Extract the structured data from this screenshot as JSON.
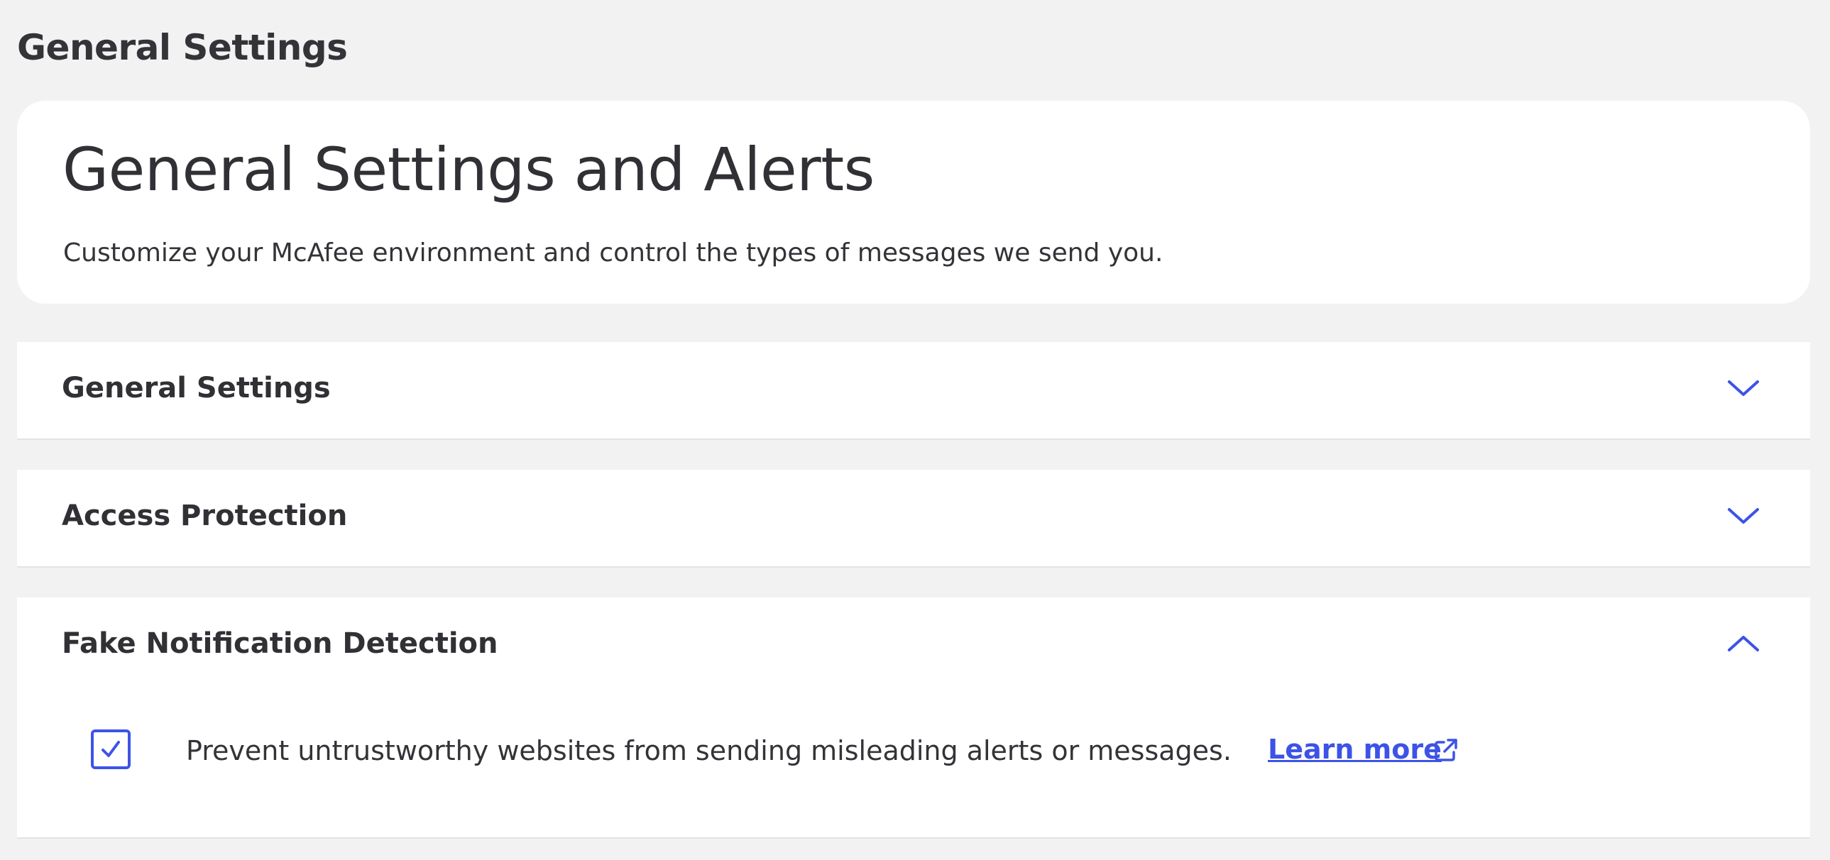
{
  "page": {
    "title": "General Settings"
  },
  "hero": {
    "title": "General Settings and Alerts",
    "subtitle": "Customize your McAfee environment and control the types of messages we send you."
  },
  "sections": [
    {
      "title": "General Settings",
      "expanded": false
    },
    {
      "title": "Access Protection",
      "expanded": false
    },
    {
      "title": "Fake Notification Detection",
      "expanded": true,
      "option": {
        "checked": true,
        "label": "Prevent untrustworthy websites from sending misleading alerts or messages.",
        "link_label": "Learn more"
      }
    }
  ],
  "colors": {
    "accent": "#3d53e6",
    "background": "#f2f2f2",
    "card": "#ffffff",
    "text": "#303035"
  },
  "icons": {
    "collapsed": "chevron-down-icon",
    "expanded": "chevron-up-icon",
    "checkbox": "checkmark-icon",
    "link": "external-link-icon"
  }
}
